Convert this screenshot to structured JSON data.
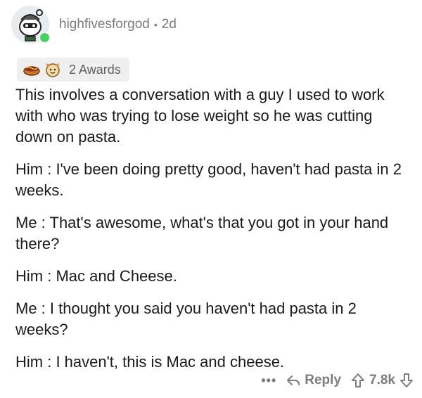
{
  "comment": {
    "username": "highfivesforgod",
    "separator": "•",
    "age": "2d",
    "awards_label": "2 Awards",
    "paragraphs": [
      "This involves a conversation with a guy I used to work with who was trying to lose weight so he was cutting down on pasta.",
      "Him : I've been doing pretty good, haven't had pasta in 2 weeks.",
      "Me : That's awesome, what's that you got in your hand there?",
      "Him : Mac and Cheese.",
      "Me : I thought you said you haven't had pasta in 2 weeks?",
      "Him : I haven't, this is Mac and cheese."
    ]
  },
  "actions": {
    "more": "•••",
    "reply": "Reply",
    "score": "7.8k"
  },
  "icons": {
    "avatar": "snoo-avatar-icon",
    "online": "online-status-icon",
    "award1": "hot-dog-award-icon",
    "award2": "wholesome-award-icon",
    "reply": "reply-arrow-icon",
    "upvote": "upvote-arrow-icon",
    "downvote": "downvote-arrow-icon"
  },
  "colors": {
    "online": "#46d160",
    "muted": "#7c7c7c",
    "text": "#1a1a1b",
    "award_bg": "#efefef"
  }
}
